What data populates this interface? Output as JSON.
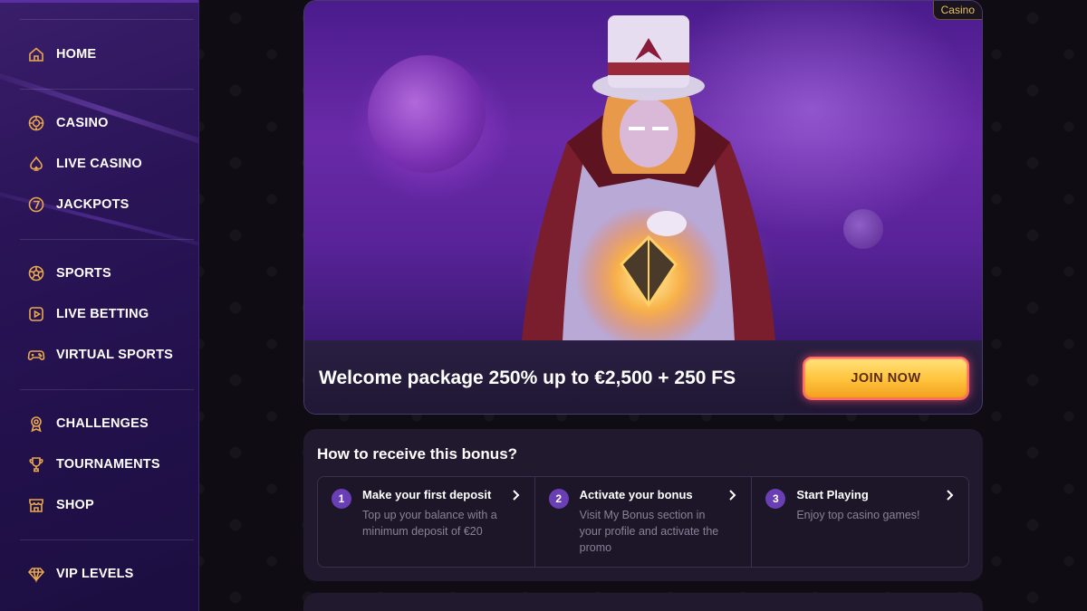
{
  "sidebar": {
    "items": [
      {
        "label": "HOME",
        "icon": "home-icon"
      },
      {
        "label": "CASINO",
        "icon": "chip-icon"
      },
      {
        "label": "LIVE CASINO",
        "icon": "spade-icon"
      },
      {
        "label": "JACKPOTS",
        "icon": "seven-icon"
      },
      {
        "label": "SPORTS",
        "icon": "ball-icon"
      },
      {
        "label": "LIVE BETTING",
        "icon": "play-icon"
      },
      {
        "label": "VIRTUAL SPORTS",
        "icon": "gamepad-icon"
      },
      {
        "label": "CHALLENGES",
        "icon": "medal-icon"
      },
      {
        "label": "TOURNAMENTS",
        "icon": "trophy-icon"
      },
      {
        "label": "SHOP",
        "icon": "shop-icon"
      },
      {
        "label": "VIP LEVELS",
        "icon": "diamond-icon"
      }
    ]
  },
  "banner": {
    "tag": "Casino",
    "title": "Welcome package 250% up to €2,500 + 250 FS",
    "cta": "JOIN NOW"
  },
  "bonus": {
    "title": "How to receive this bonus?",
    "steps": [
      {
        "num": "1",
        "title": "Make your first deposit",
        "desc": "Top up your balance with a minimum deposit of €20"
      },
      {
        "num": "2",
        "title": "Activate your bonus",
        "desc": "Visit My Bonus section in your profile and activate the promo"
      },
      {
        "num": "3",
        "title": "Start Playing",
        "desc": "Enjoy top casino games!"
      }
    ]
  },
  "colors": {
    "accent": "#e9a94c",
    "sidebar": "#2a1457",
    "cta": "#ffc23a"
  }
}
